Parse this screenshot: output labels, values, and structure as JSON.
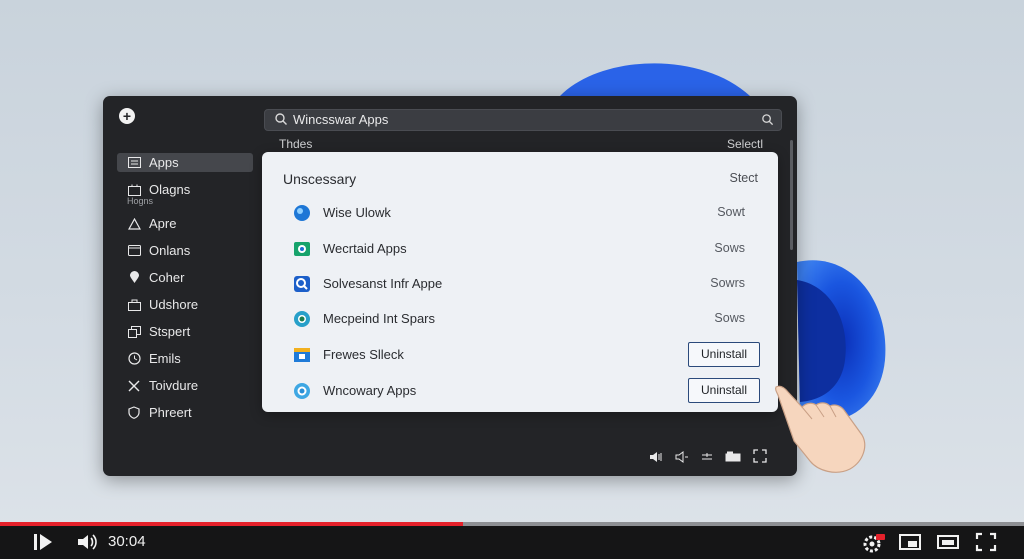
{
  "window": {
    "search": {
      "value": "Wincsswar Apps"
    },
    "header": {
      "left": "Thdes",
      "right": "Selectl"
    }
  },
  "sidebar": {
    "items": [
      {
        "label": "Apps",
        "icon": "apps-icon",
        "active": true
      },
      {
        "label": "Olagns",
        "icon": "box-icon",
        "sub": "Hogns"
      },
      {
        "label": "Apre",
        "icon": "triangle-icon"
      },
      {
        "label": "Onlans",
        "icon": "window-icon"
      },
      {
        "label": "Coher",
        "icon": "location-icon"
      },
      {
        "label": "Udshore",
        "icon": "store-icon"
      },
      {
        "label": "Stspert",
        "icon": "layers-icon"
      },
      {
        "label": "Emils",
        "icon": "clock-icon"
      },
      {
        "label": "Toivdure",
        "icon": "close-icon"
      },
      {
        "label": "Phreert",
        "icon": "shield-icon"
      }
    ]
  },
  "panel": {
    "title": "Unscessary",
    "right": "Stect",
    "rows": [
      {
        "name": "Wise Ulowk",
        "status": "Sowt",
        "icon": "globe-icon",
        "action": ""
      },
      {
        "name": "Wecrtaid Apps",
        "status": "Sows",
        "icon": "camera-icon",
        "action": ""
      },
      {
        "name": "Solvesanst Infr Appe",
        "status": "Sowrs",
        "icon": "search-icon",
        "action": ""
      },
      {
        "name": "Mecpeind Int Spars",
        "status": "Sows",
        "icon": "chrome-icon",
        "action": ""
      },
      {
        "name": "Frewes Slleck",
        "status": "",
        "icon": "store-icon",
        "action": "Uninstall"
      },
      {
        "name": "Wncowary Apps",
        "status": "",
        "icon": "circle-icon",
        "action": "Uninstall"
      }
    ]
  },
  "video": {
    "time": "30:04",
    "progress": 0.452,
    "accent": "#e5212b"
  }
}
